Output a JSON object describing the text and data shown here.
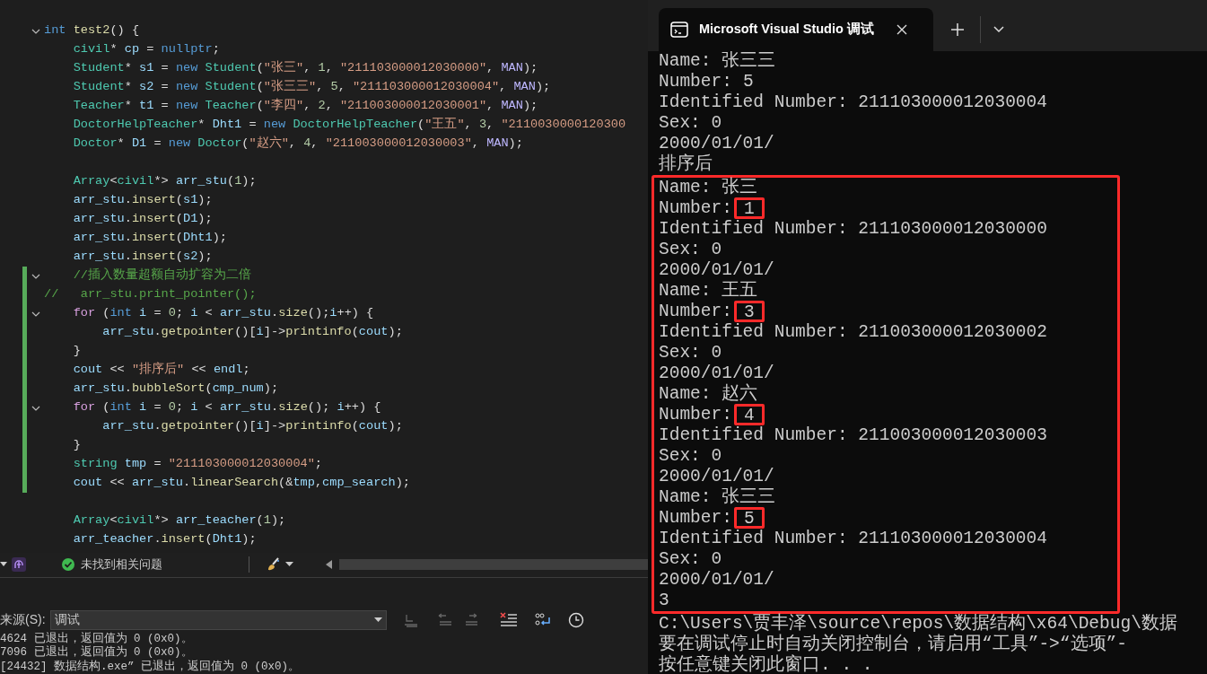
{
  "editor": {
    "lines": [
      {
        "kind": "code",
        "fold": true,
        "changed": false,
        "tokens": [
          {
            "text": "int ",
            "kind": "kw"
          },
          {
            "text": "test2",
            "kind": "fn"
          },
          {
            "text": "() {",
            "kind": "plain"
          }
        ]
      },
      {
        "kind": "code",
        "fold": false,
        "changed": false,
        "tokens": [
          {
            "text": "    civil",
            "kind": "type"
          },
          {
            "text": "* ",
            "kind": "plain"
          },
          {
            "text": "cp",
            "kind": "var"
          },
          {
            "text": " = ",
            "kind": "plain"
          },
          {
            "text": "nullptr",
            "kind": "kw"
          },
          {
            "text": ";",
            "kind": "plain"
          }
        ]
      },
      {
        "kind": "code",
        "fold": false,
        "changed": false,
        "tokens": [
          {
            "text": "    Student",
            "kind": "type"
          },
          {
            "text": "* ",
            "kind": "plain"
          },
          {
            "text": "s1",
            "kind": "var"
          },
          {
            "text": " = ",
            "kind": "plain"
          },
          {
            "text": "new ",
            "kind": "kw"
          },
          {
            "text": "Student",
            "kind": "type"
          },
          {
            "text": "(",
            "kind": "plain"
          },
          {
            "text": "\"张三\"",
            "kind": "str"
          },
          {
            "text": ", ",
            "kind": "plain"
          },
          {
            "text": "1",
            "kind": "num"
          },
          {
            "text": ", ",
            "kind": "plain"
          },
          {
            "text": "\"211103000012030000\"",
            "kind": "str"
          },
          {
            "text": ", ",
            "kind": "plain"
          },
          {
            "text": "MAN",
            "kind": "macro"
          },
          {
            "text": ");",
            "kind": "plain"
          }
        ]
      },
      {
        "kind": "code",
        "fold": false,
        "changed": false,
        "tokens": [
          {
            "text": "    Student",
            "kind": "type"
          },
          {
            "text": "* ",
            "kind": "plain"
          },
          {
            "text": "s2",
            "kind": "var"
          },
          {
            "text": " = ",
            "kind": "plain"
          },
          {
            "text": "new ",
            "kind": "kw"
          },
          {
            "text": "Student",
            "kind": "type"
          },
          {
            "text": "(",
            "kind": "plain"
          },
          {
            "text": "\"张三三\"",
            "kind": "str"
          },
          {
            "text": ", ",
            "kind": "plain"
          },
          {
            "text": "5",
            "kind": "num"
          },
          {
            "text": ", ",
            "kind": "plain"
          },
          {
            "text": "\"211103000012030004\"",
            "kind": "str"
          },
          {
            "text": ", ",
            "kind": "plain"
          },
          {
            "text": "MAN",
            "kind": "macro"
          },
          {
            "text": ");",
            "kind": "plain"
          }
        ]
      },
      {
        "kind": "code",
        "fold": false,
        "changed": false,
        "tokens": [
          {
            "text": "    Teacher",
            "kind": "type"
          },
          {
            "text": "* ",
            "kind": "plain"
          },
          {
            "text": "t1",
            "kind": "var"
          },
          {
            "text": " = ",
            "kind": "plain"
          },
          {
            "text": "new ",
            "kind": "kw"
          },
          {
            "text": "Teacher",
            "kind": "type"
          },
          {
            "text": "(",
            "kind": "plain"
          },
          {
            "text": "\"李四\"",
            "kind": "str"
          },
          {
            "text": ", ",
            "kind": "plain"
          },
          {
            "text": "2",
            "kind": "num"
          },
          {
            "text": ", ",
            "kind": "plain"
          },
          {
            "text": "\"211003000012030001\"",
            "kind": "str"
          },
          {
            "text": ", ",
            "kind": "plain"
          },
          {
            "text": "MAN",
            "kind": "macro"
          },
          {
            "text": ");",
            "kind": "plain"
          }
        ]
      },
      {
        "kind": "code",
        "fold": false,
        "changed": false,
        "tokens": [
          {
            "text": "    DoctorHelpTeacher",
            "kind": "type"
          },
          {
            "text": "* ",
            "kind": "plain"
          },
          {
            "text": "Dht1",
            "kind": "var"
          },
          {
            "text": " = ",
            "kind": "plain"
          },
          {
            "text": "new ",
            "kind": "kw"
          },
          {
            "text": "DoctorHelpTeacher",
            "kind": "type"
          },
          {
            "text": "(",
            "kind": "plain"
          },
          {
            "text": "\"王五\"",
            "kind": "str"
          },
          {
            "text": ", ",
            "kind": "plain"
          },
          {
            "text": "3",
            "kind": "num"
          },
          {
            "text": ", ",
            "kind": "plain"
          },
          {
            "text": "\"2110030000120300",
            "kind": "str"
          }
        ]
      },
      {
        "kind": "code",
        "fold": false,
        "changed": false,
        "tokens": [
          {
            "text": "    Doctor",
            "kind": "type"
          },
          {
            "text": "* ",
            "kind": "plain"
          },
          {
            "text": "D1",
            "kind": "var"
          },
          {
            "text": " = ",
            "kind": "plain"
          },
          {
            "text": "new ",
            "kind": "kw"
          },
          {
            "text": "Doctor",
            "kind": "type"
          },
          {
            "text": "(",
            "kind": "plain"
          },
          {
            "text": "\"赵六\"",
            "kind": "str"
          },
          {
            "text": ", ",
            "kind": "plain"
          },
          {
            "text": "4",
            "kind": "num"
          },
          {
            "text": ", ",
            "kind": "plain"
          },
          {
            "text": "\"211003000012030003\"",
            "kind": "str"
          },
          {
            "text": ", ",
            "kind": "plain"
          },
          {
            "text": "MAN",
            "kind": "macro"
          },
          {
            "text": ");",
            "kind": "plain"
          }
        ]
      },
      {
        "kind": "blank"
      },
      {
        "kind": "code",
        "fold": false,
        "changed": false,
        "tokens": [
          {
            "text": "    Array",
            "kind": "type"
          },
          {
            "text": "<",
            "kind": "plain"
          },
          {
            "text": "civil",
            "kind": "type"
          },
          {
            "text": "*> ",
            "kind": "plain"
          },
          {
            "text": "arr_stu",
            "kind": "var"
          },
          {
            "text": "(",
            "kind": "plain"
          },
          {
            "text": "1",
            "kind": "num"
          },
          {
            "text": ");",
            "kind": "plain"
          }
        ]
      },
      {
        "kind": "code",
        "fold": false,
        "changed": false,
        "tokens": [
          {
            "text": "    arr_stu",
            "kind": "var"
          },
          {
            "text": ".",
            "kind": "plain"
          },
          {
            "text": "insert",
            "kind": "fn"
          },
          {
            "text": "(",
            "kind": "plain"
          },
          {
            "text": "s1",
            "kind": "var"
          },
          {
            "text": ");",
            "kind": "plain"
          }
        ]
      },
      {
        "kind": "code",
        "fold": false,
        "changed": false,
        "tokens": [
          {
            "text": "    arr_stu",
            "kind": "var"
          },
          {
            "text": ".",
            "kind": "plain"
          },
          {
            "text": "insert",
            "kind": "fn"
          },
          {
            "text": "(",
            "kind": "plain"
          },
          {
            "text": "D1",
            "kind": "var"
          },
          {
            "text": ");",
            "kind": "plain"
          }
        ]
      },
      {
        "kind": "code",
        "fold": false,
        "changed": false,
        "tokens": [
          {
            "text": "    arr_stu",
            "kind": "var"
          },
          {
            "text": ".",
            "kind": "plain"
          },
          {
            "text": "insert",
            "kind": "fn"
          },
          {
            "text": "(",
            "kind": "plain"
          },
          {
            "text": "Dht1",
            "kind": "var"
          },
          {
            "text": ");",
            "kind": "plain"
          }
        ]
      },
      {
        "kind": "code",
        "fold": false,
        "changed": false,
        "tokens": [
          {
            "text": "    arr_stu",
            "kind": "var"
          },
          {
            "text": ".",
            "kind": "plain"
          },
          {
            "text": "insert",
            "kind": "fn"
          },
          {
            "text": "(",
            "kind": "plain"
          },
          {
            "text": "s2",
            "kind": "var"
          },
          {
            "text": ");",
            "kind": "plain"
          }
        ]
      },
      {
        "kind": "code",
        "fold": true,
        "changed": true,
        "tokens": [
          {
            "text": "    //插入数量超额自动扩容为二倍",
            "kind": "cmt"
          }
        ]
      },
      {
        "kind": "code",
        "fold": false,
        "changed": true,
        "tokens": [
          {
            "text": "//   arr_stu.print_pointer();",
            "kind": "cmt"
          }
        ]
      },
      {
        "kind": "code",
        "fold": true,
        "changed": true,
        "tokens": [
          {
            "text": "    for ",
            "kind": "ctrl"
          },
          {
            "text": "(",
            "kind": "plain"
          },
          {
            "text": "int ",
            "kind": "kw"
          },
          {
            "text": "i",
            "kind": "var"
          },
          {
            "text": " = ",
            "kind": "plain"
          },
          {
            "text": "0",
            "kind": "num"
          },
          {
            "text": "; ",
            "kind": "plain"
          },
          {
            "text": "i",
            "kind": "var"
          },
          {
            "text": " < ",
            "kind": "plain"
          },
          {
            "text": "arr_stu",
            "kind": "var"
          },
          {
            "text": ".",
            "kind": "plain"
          },
          {
            "text": "size",
            "kind": "fn"
          },
          {
            "text": "();",
            "kind": "plain"
          },
          {
            "text": "i",
            "kind": "var"
          },
          {
            "text": "++) {",
            "kind": "plain"
          }
        ]
      },
      {
        "kind": "code",
        "fold": false,
        "changed": true,
        "tokens": [
          {
            "text": "        arr_stu",
            "kind": "var"
          },
          {
            "text": ".",
            "kind": "plain"
          },
          {
            "text": "getpointer",
            "kind": "fn"
          },
          {
            "text": "()[",
            "kind": "plain"
          },
          {
            "text": "i",
            "kind": "var"
          },
          {
            "text": "]->",
            "kind": "plain"
          },
          {
            "text": "printinfo",
            "kind": "fn"
          },
          {
            "text": "(",
            "kind": "plain"
          },
          {
            "text": "cout",
            "kind": "var"
          },
          {
            "text": ");",
            "kind": "plain"
          }
        ]
      },
      {
        "kind": "code",
        "fold": false,
        "changed": true,
        "tokens": [
          {
            "text": "    }",
            "kind": "plain"
          }
        ]
      },
      {
        "kind": "code",
        "fold": false,
        "changed": true,
        "tokens": [
          {
            "text": "    cout",
            "kind": "var"
          },
          {
            "text": " << ",
            "kind": "plain"
          },
          {
            "text": "\"排序后\"",
            "kind": "str"
          },
          {
            "text": " << ",
            "kind": "plain"
          },
          {
            "text": "endl",
            "kind": "var"
          },
          {
            "text": ";",
            "kind": "plain"
          }
        ]
      },
      {
        "kind": "code",
        "fold": false,
        "changed": true,
        "tokens": [
          {
            "text": "    arr_stu",
            "kind": "var"
          },
          {
            "text": ".",
            "kind": "plain"
          },
          {
            "text": "bubbleSort",
            "kind": "fn"
          },
          {
            "text": "(",
            "kind": "plain"
          },
          {
            "text": "cmp_num",
            "kind": "var"
          },
          {
            "text": ");",
            "kind": "plain"
          }
        ]
      },
      {
        "kind": "code",
        "fold": true,
        "changed": true,
        "tokens": [
          {
            "text": "    for ",
            "kind": "ctrl"
          },
          {
            "text": "(",
            "kind": "plain"
          },
          {
            "text": "int ",
            "kind": "kw"
          },
          {
            "text": "i",
            "kind": "var"
          },
          {
            "text": " = ",
            "kind": "plain"
          },
          {
            "text": "0",
            "kind": "num"
          },
          {
            "text": "; ",
            "kind": "plain"
          },
          {
            "text": "i",
            "kind": "var"
          },
          {
            "text": " < ",
            "kind": "plain"
          },
          {
            "text": "arr_stu",
            "kind": "var"
          },
          {
            "text": ".",
            "kind": "plain"
          },
          {
            "text": "size",
            "kind": "fn"
          },
          {
            "text": "(); ",
            "kind": "plain"
          },
          {
            "text": "i",
            "kind": "var"
          },
          {
            "text": "++) {",
            "kind": "plain"
          }
        ]
      },
      {
        "kind": "code",
        "fold": false,
        "changed": true,
        "tokens": [
          {
            "text": "        arr_stu",
            "kind": "var"
          },
          {
            "text": ".",
            "kind": "plain"
          },
          {
            "text": "getpointer",
            "kind": "fn"
          },
          {
            "text": "()[",
            "kind": "plain"
          },
          {
            "text": "i",
            "kind": "var"
          },
          {
            "text": "]->",
            "kind": "plain"
          },
          {
            "text": "printinfo",
            "kind": "fn"
          },
          {
            "text": "(",
            "kind": "plain"
          },
          {
            "text": "cout",
            "kind": "var"
          },
          {
            "text": ");",
            "kind": "plain"
          }
        ]
      },
      {
        "kind": "code",
        "fold": false,
        "changed": true,
        "tokens": [
          {
            "text": "    }",
            "kind": "plain"
          }
        ]
      },
      {
        "kind": "code",
        "fold": false,
        "changed": true,
        "tokens": [
          {
            "text": "    string ",
            "kind": "type"
          },
          {
            "text": "tmp",
            "kind": "var"
          },
          {
            "text": " = ",
            "kind": "plain"
          },
          {
            "text": "\"211103000012030004\"",
            "kind": "str"
          },
          {
            "text": ";",
            "kind": "plain"
          }
        ]
      },
      {
        "kind": "code",
        "fold": false,
        "changed": true,
        "tokens": [
          {
            "text": "    cout",
            "kind": "var"
          },
          {
            "text": " << ",
            "kind": "plain"
          },
          {
            "text": "arr_stu",
            "kind": "var"
          },
          {
            "text": ".",
            "kind": "plain"
          },
          {
            "text": "linearSearch",
            "kind": "fn"
          },
          {
            "text": "(&",
            "kind": "plain"
          },
          {
            "text": "tmp",
            "kind": "var"
          },
          {
            "text": ",",
            "kind": "plain"
          },
          {
            "text": "cmp_search",
            "kind": "var"
          },
          {
            "text": ");",
            "kind": "plain"
          }
        ]
      },
      {
        "kind": "blank"
      },
      {
        "kind": "code",
        "fold": false,
        "changed": false,
        "tokens": [
          {
            "text": "    Array",
            "kind": "type"
          },
          {
            "text": "<",
            "kind": "plain"
          },
          {
            "text": "civil",
            "kind": "type"
          },
          {
            "text": "*> ",
            "kind": "plain"
          },
          {
            "text": "arr_teacher",
            "kind": "var"
          },
          {
            "text": "(",
            "kind": "plain"
          },
          {
            "text": "1",
            "kind": "num"
          },
          {
            "text": ");",
            "kind": "plain"
          }
        ]
      },
      {
        "kind": "code",
        "fold": false,
        "changed": false,
        "tokens": [
          {
            "text": "    arr_teacher",
            "kind": "var"
          },
          {
            "text": ".",
            "kind": "plain"
          },
          {
            "text": "insert",
            "kind": "fn"
          },
          {
            "text": "(",
            "kind": "plain"
          },
          {
            "text": "Dht1",
            "kind": "var"
          },
          {
            "text": ");",
            "kind": "plain"
          }
        ]
      }
    ]
  },
  "status_bar": {
    "issues": "未找到相关问题"
  },
  "output_panel": {
    "source_label": "来源(S):",
    "source_value": "调试",
    "lines": [
      "4624 已退出，返回值为 0 (0x0)。",
      "7096 已退出，返回值为 0 (0x0)。",
      "[24432] 数据结构.exe” 已退出，返回值为 0 (0x0)。"
    ]
  },
  "terminal": {
    "tab_title": "Microsoft Visual Studio 调试",
    "lines_before": [
      {
        "kind": "text",
        "text": "Name: 张三三"
      },
      {
        "kind": "number",
        "label": "Number:",
        "value": "5",
        "boxed": false
      },
      {
        "kind": "text",
        "text": "Identified Number: 211103000012030004"
      },
      {
        "kind": "text",
        "text": "Sex: 0"
      },
      {
        "kind": "text",
        "text": "2000/01/01/"
      },
      {
        "kind": "text",
        "text": "排序后"
      }
    ],
    "highlighted_lines": [
      {
        "kind": "text",
        "text": "Name: 张三"
      },
      {
        "kind": "number",
        "label": "Number:",
        "value": "1",
        "boxed": true
      },
      {
        "kind": "text",
        "text": "Identified Number: 211103000012030000"
      },
      {
        "kind": "text",
        "text": "Sex: 0"
      },
      {
        "kind": "text",
        "text": "2000/01/01/"
      },
      {
        "kind": "text",
        "text": "Name: 王五"
      },
      {
        "kind": "number",
        "label": "Number:",
        "value": "3",
        "boxed": true
      },
      {
        "kind": "text",
        "text": "Identified Number: 211003000012030002"
      },
      {
        "kind": "text",
        "text": "Sex: 0"
      },
      {
        "kind": "text",
        "text": "2000/01/01/"
      },
      {
        "kind": "text",
        "text": "Name: 赵六"
      },
      {
        "kind": "number",
        "label": "Number:",
        "value": "4",
        "boxed": true
      },
      {
        "kind": "text",
        "text": "Identified Number: 211003000012030003"
      },
      {
        "kind": "text",
        "text": "Sex: 0"
      },
      {
        "kind": "text",
        "text": "2000/01/01/"
      },
      {
        "kind": "text",
        "text": "Name: 张三三"
      },
      {
        "kind": "number",
        "label": "Number:",
        "value": "5",
        "boxed": true
      },
      {
        "kind": "text",
        "text": "Identified Number: 211103000012030004"
      },
      {
        "kind": "text",
        "text": "Sex: 0"
      },
      {
        "kind": "text",
        "text": "2000/01/01/"
      },
      {
        "kind": "text",
        "text": "3"
      }
    ],
    "lines_after": [
      {
        "kind": "text",
        "text": "C:\\Users\\贾丰泽\\source\\repos\\数据结构\\x64\\Debug\\数据"
      },
      {
        "kind": "text",
        "text": "要在调试停止时自动关闭控制台，请启用“工具”->“选项”-"
      },
      {
        "kind": "text",
        "text": "按任意键关闭此窗口. . ."
      }
    ]
  }
}
